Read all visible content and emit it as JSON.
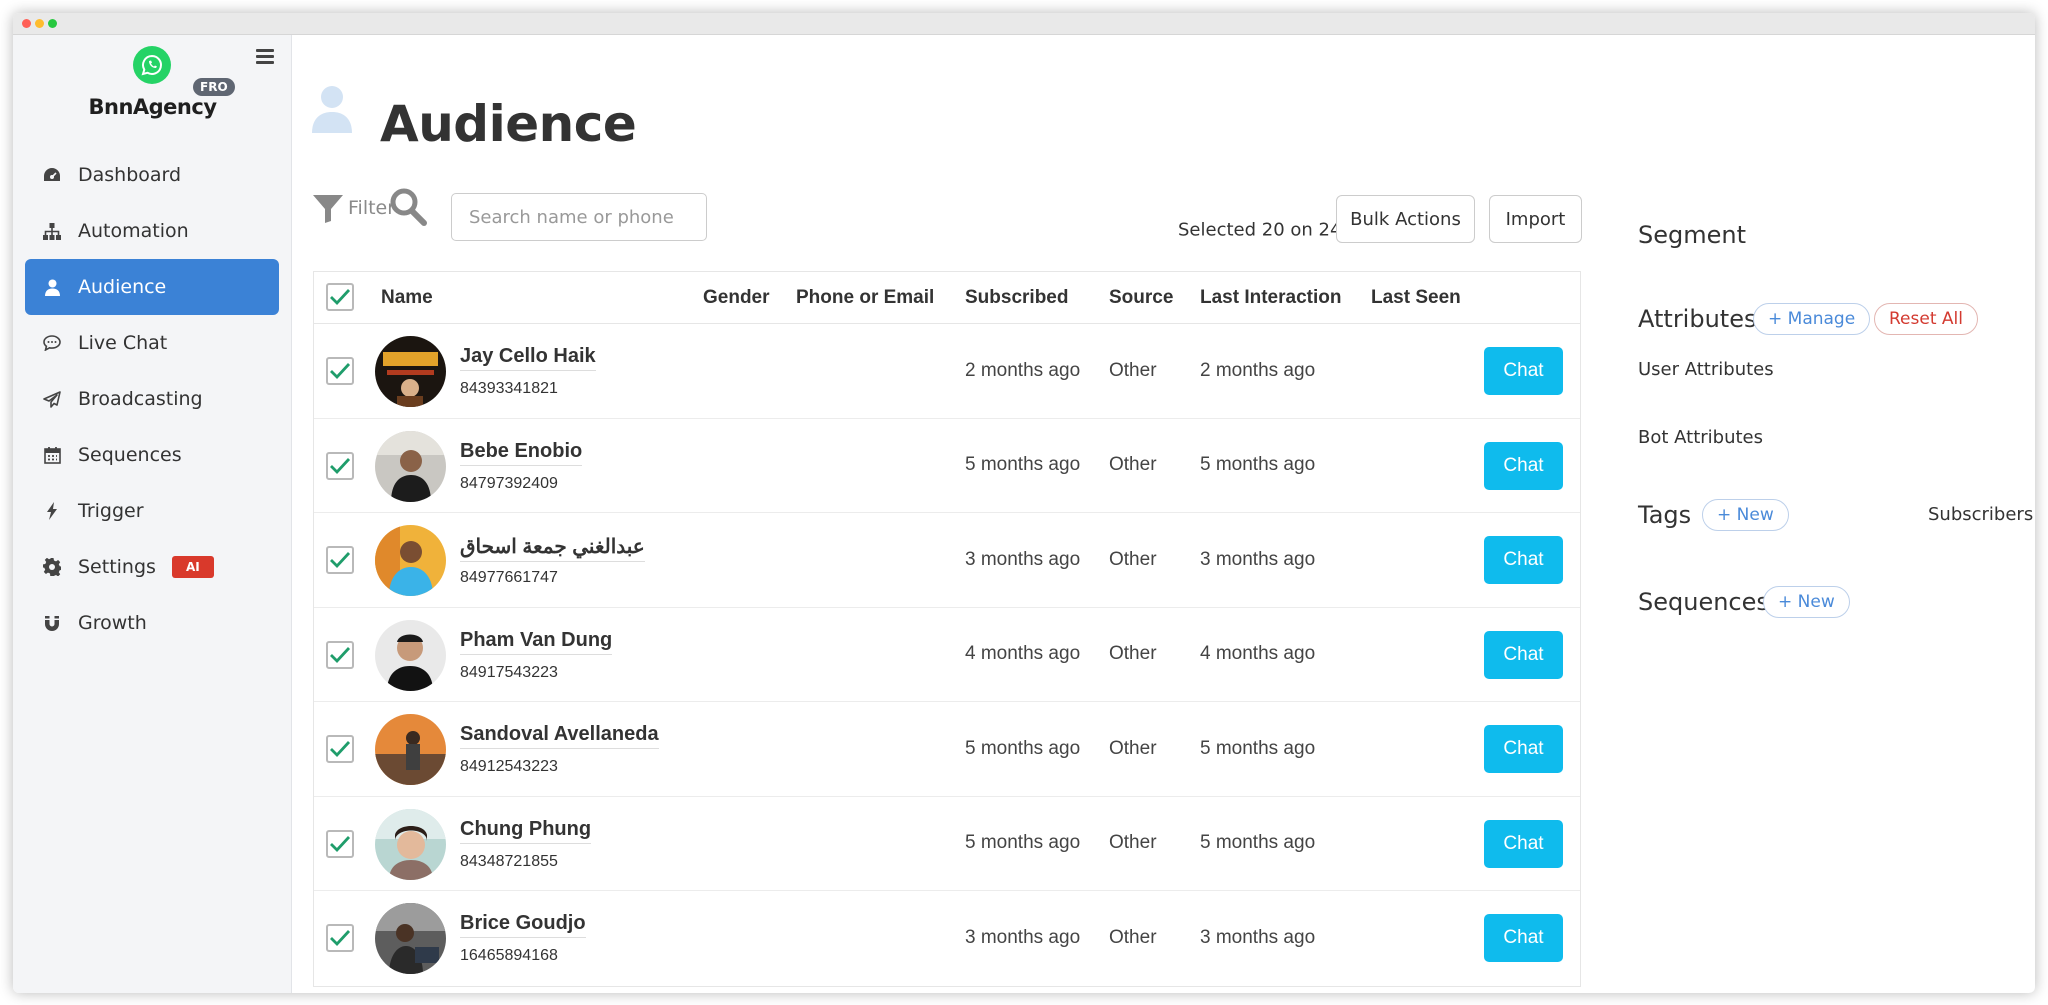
{
  "sidebar": {
    "brand": "BnnAgency",
    "plan_badge": "FRO",
    "items": [
      {
        "label": "Dashboard",
        "icon": "dashboard-icon"
      },
      {
        "label": "Automation",
        "icon": "sitemap-icon"
      },
      {
        "label": "Audience",
        "icon": "user-icon",
        "active": true
      },
      {
        "label": "Live Chat",
        "icon": "chat-bubble-icon"
      },
      {
        "label": "Broadcasting",
        "icon": "paper-plane-icon"
      },
      {
        "label": "Sequences",
        "icon": "calendar-icon"
      },
      {
        "label": "Trigger",
        "icon": "bolt-icon"
      },
      {
        "label": "Settings",
        "icon": "gear-icon",
        "badge": "AI"
      },
      {
        "label": "Growth",
        "icon": "magnet-icon"
      }
    ]
  },
  "page": {
    "title": "Audience"
  },
  "toolbar": {
    "filter_label": "Filter",
    "search_placeholder": "Search name or phone",
    "selected_text": "Selected 20 on 244",
    "bulk_actions_label": "Bulk Actions",
    "import_label": "Import"
  },
  "table": {
    "columns": [
      "Name",
      "Gender",
      "Phone or Email",
      "Subscribed",
      "Source",
      "Last Interaction",
      "Last Seen"
    ],
    "chat_label": "Chat",
    "rows": [
      {
        "name": "Jay Cello Haik",
        "phone": "84393341821",
        "subscribed": "2 months ago",
        "source": "Other",
        "last_interaction": "2 months ago"
      },
      {
        "name": "Bebe Enobio",
        "phone": "84797392409",
        "subscribed": "5 months ago",
        "source": "Other",
        "last_interaction": "5 months ago"
      },
      {
        "name": "عبدالغني جمعة اسحاق",
        "phone": "84977661747",
        "subscribed": "3 months ago",
        "source": "Other",
        "last_interaction": "3 months ago"
      },
      {
        "name": "Pham Van Dung",
        "phone": "84917543223",
        "subscribed": "4 months ago",
        "source": "Other",
        "last_interaction": "4 months ago"
      },
      {
        "name": "Sandoval Avellaneda",
        "phone": "84912543223",
        "subscribed": "5 months ago",
        "source": "Other",
        "last_interaction": "5 months ago"
      },
      {
        "name": "Chung Phung",
        "phone": "84348721855",
        "subscribed": "5 months ago",
        "source": "Other",
        "last_interaction": "5 months ago"
      },
      {
        "name": "Brice Goudjo",
        "phone": "16465894168",
        "subscribed": "3 months ago",
        "source": "Other",
        "last_interaction": "3 months ago"
      }
    ]
  },
  "right_panel": {
    "segment_title": "Segment",
    "attributes_title": "Attributes",
    "manage_label": "+ Manage",
    "reset_label": "Reset All",
    "user_attributes": "User Attributes",
    "bot_attributes": "Bot Attributes",
    "tags_title": "Tags",
    "tags_new_label": "+ New",
    "subscribers_label": "Subscribers",
    "sequences_title": "Sequences",
    "sequences_new_label": "+ New"
  },
  "colors": {
    "accent": "#3b82d6",
    "chat_button": "#0fbbed",
    "check": "#1f9d6b",
    "ai_badge": "#d9392b"
  }
}
